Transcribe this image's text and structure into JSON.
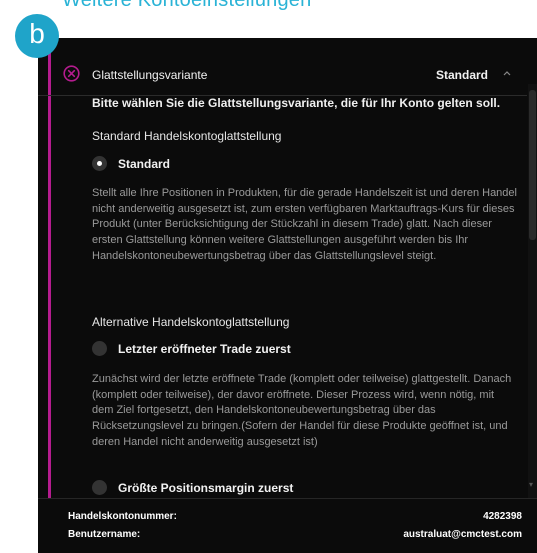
{
  "page": {
    "title": "Weitere Kontoeinstellungen",
    "step_badge": "b"
  },
  "header": {
    "label": "Glattstellungsvariante",
    "value": "Standard"
  },
  "content": {
    "prompt": "Bitte wählen Sie die Glattstellungsvariante, die für Ihr Konto gelten soll.",
    "section_standard": "Standard Handelskontoglattstellung",
    "option_standard": {
      "label": "Standard",
      "selected": true,
      "description": "Stellt alle Ihre Positionen in Produkten, für die gerade Handelszeit ist und deren Handel nicht anderweitig ausgesetzt ist, zum ersten verfügbaren Marktauftrags-Kurs für dieses Produkt (unter Berücksichtigung der Stückzahl in diesem Trade) glatt. Nach dieser ersten Glattstellung können weitere Glattstellungen ausgeführt werden bis Ihr Handelskontoneubewertungsbetrag über das Glattstellungslevel steigt."
    },
    "section_alternative": "Alternative Handelskontoglattstellung",
    "option_last_trade": {
      "label": "Letzter eröffneter Trade zuerst",
      "selected": false,
      "description": "Zunächst wird der letzte eröffnete Trade (komplett oder teilweise) glattgestellt. Danach (komplett oder teilweise), der davor eröffnete. Dieser Prozess wird, wenn nötig, mit dem Ziel fortgesetzt, den Handelskontoneubewertungsbetrag über das Rücksetzungslevel zu bringen.(Sofern der Handel für diese Produkte geöffnet ist, und deren Handel nicht anderweitig ausgesetzt ist)"
    },
    "option_largest_margin": {
      "label": "Größte Positionsmargin zuerst",
      "selected": false
    }
  },
  "footer": {
    "account_number_label": "Handelskontonummer:",
    "account_number_value": "4282398",
    "username_label": "Benutzername:",
    "username_value": "australuat@cmctest.com"
  },
  "colors": {
    "accent": "#b51c8f",
    "brand": "#1fa4c9",
    "panel_bg": "#0b0b0b"
  },
  "icons": {
    "close": "close-circle-icon",
    "collapse": "chevron-up-icon"
  }
}
